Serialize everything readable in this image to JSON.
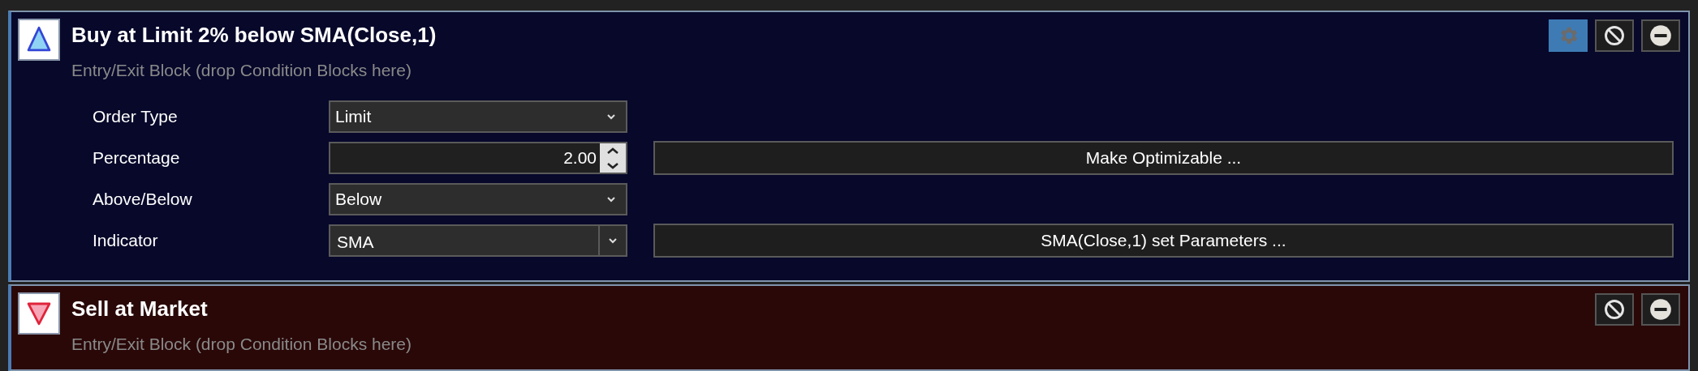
{
  "blocks": [
    {
      "kind": "entry",
      "title": "Buy at Limit 2% below SMA(Close,1)",
      "subtitle": "Entry/Exit Block (drop Condition Blocks here)",
      "tools": [
        {
          "kind": "settings",
          "selected": true
        },
        {
          "kind": "disable",
          "selected": false
        },
        {
          "kind": "remove",
          "selected": false
        }
      ],
      "fields": [
        {
          "label": "Order Type",
          "kind": "dropdown",
          "value": "Limit"
        },
        {
          "label": "Percentage",
          "kind": "spinner",
          "value": "2.00",
          "action": "Make Optimizable ..."
        },
        {
          "label": "Above/Below",
          "kind": "dropdown",
          "value": "Below"
        },
        {
          "label": "Indicator",
          "kind": "combo",
          "value": "SMA",
          "action": "SMA(Close,1) set Parameters ..."
        }
      ]
    },
    {
      "kind": "exit",
      "title": "Sell at Market",
      "subtitle": "Entry/Exit Block (drop Condition Blocks here)",
      "tools": [
        {
          "kind": "disable",
          "selected": false
        },
        {
          "kind": "remove",
          "selected": false
        }
      ]
    }
  ]
}
